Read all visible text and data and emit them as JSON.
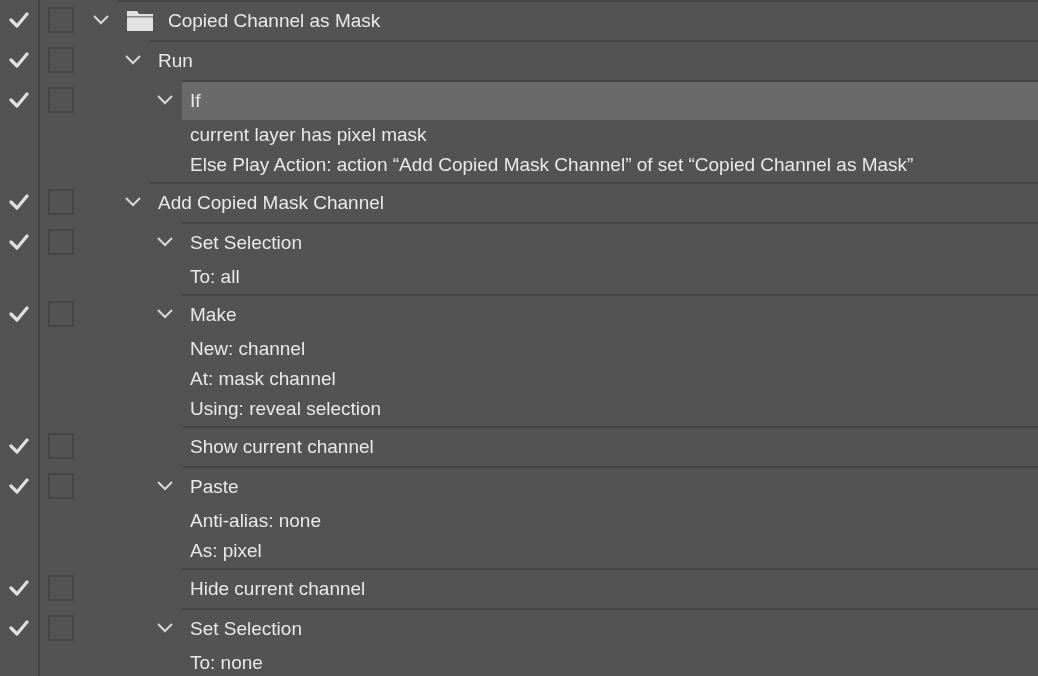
{
  "actions": [
    {
      "kind": "set",
      "label": "Copied Channel as Mask",
      "enabled": true,
      "dialog": false,
      "expanded": true,
      "selected": false,
      "children": [
        {
          "label": "Run",
          "enabled": true,
          "dialog": false,
          "expanded": true,
          "selected": false,
          "children": [
            {
              "label": "If",
              "enabled": true,
              "dialog": false,
              "expanded": true,
              "selected": true,
              "details": [
                "current layer has pixel mask",
                "Else Play Action: action “Add Copied Mask Channel” of set “Copied Channel as Mask”"
              ]
            }
          ]
        },
        {
          "label": "Add Copied Mask Channel",
          "enabled": true,
          "dialog": false,
          "expanded": true,
          "selected": false,
          "children": [
            {
              "label": "Set Selection",
              "enabled": true,
              "dialog": false,
              "expanded": true,
              "selected": false,
              "details": [
                "To: all"
              ]
            },
            {
              "label": "Make",
              "enabled": true,
              "dialog": false,
              "expanded": true,
              "selected": false,
              "details": [
                "New: channel",
                "At: mask channel",
                "Using: reveal selection"
              ]
            },
            {
              "label": "Show current channel",
              "enabled": true,
              "dialog": false,
              "selected": false
            },
            {
              "label": "Paste",
              "enabled": true,
              "dialog": false,
              "expanded": true,
              "selected": false,
              "details": [
                "Anti-alias: none",
                "As: pixel"
              ]
            },
            {
              "label": "Hide current channel",
              "enabled": true,
              "dialog": false,
              "selected": false
            },
            {
              "label": "Set Selection",
              "enabled": true,
              "dialog": false,
              "expanded": true,
              "selected": false,
              "details": [
                "To: none"
              ]
            }
          ]
        }
      ]
    }
  ]
}
